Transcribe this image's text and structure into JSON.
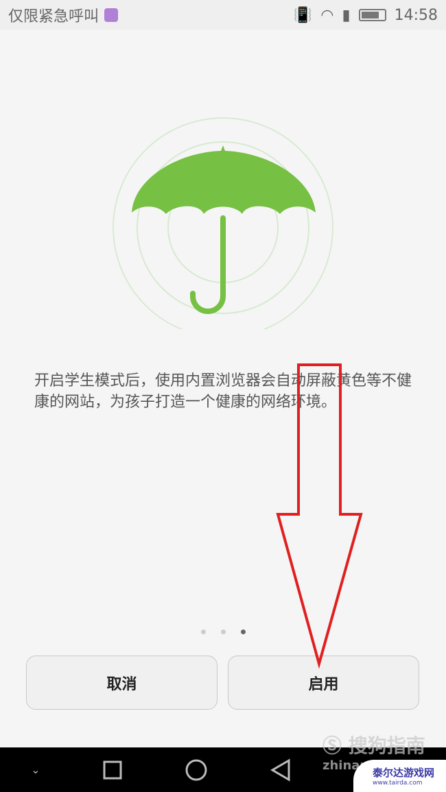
{
  "status_bar": {
    "carrier": "仅限紧急呼叫",
    "time": "14:58",
    "icons": [
      "vibrate-icon",
      "wifi-icon",
      "sim-alert-icon",
      "battery-icon"
    ]
  },
  "illustration": {
    "icon": "umbrella-icon",
    "color": "#76c043"
  },
  "description": "开启学生模式后，使用内置浏览器会自动屏蔽黄色等不健康的网站，为孩子打造一个健康的网络环境。",
  "pager": {
    "count": 3,
    "active": 3
  },
  "buttons": {
    "cancel": "取消",
    "enable": "启用"
  },
  "nav": [
    "back-chevron-icon",
    "recents-icon",
    "home-icon",
    "back-icon"
  ],
  "watermarks": {
    "sogou": "搜狗指南",
    "zhinan": "zhinan",
    "tairda_name": "泰尔达游戏网",
    "tairda_url": "www.tairda.com"
  },
  "annotation": {
    "type": "red-arrow",
    "color": "#e02020"
  }
}
